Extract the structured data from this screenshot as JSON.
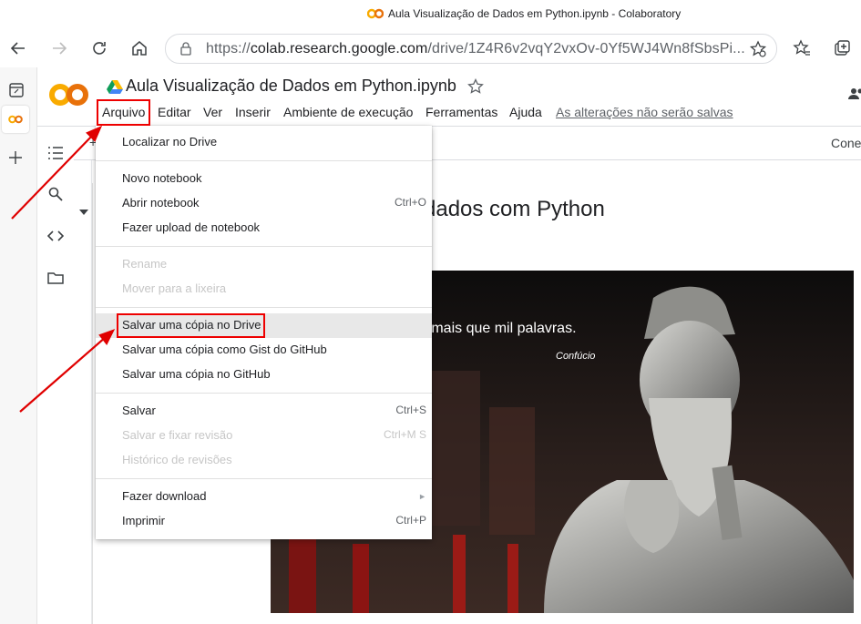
{
  "window": {
    "title": "Aula Visualização de Dados em Python.ipynb - Colaboratory"
  },
  "browser": {
    "url_prefix": "https://",
    "url_host": "colab.research.google.com",
    "url_path": "/drive/1Z4R6v2vqY2vxOv-0Yf5WJ4Wn8fSbsPi..."
  },
  "colab": {
    "logo_text": "CO",
    "filename": "Aula Visualização de Dados em Python.ipynb",
    "menu": [
      "Arquivo",
      "Editar",
      "Ver",
      "Inserir",
      "Ambiente de execução",
      "Ferramentas",
      "Ajuda"
    ],
    "unsaved_notice": "As alterações não serão salvas",
    "connect_label": "Cone",
    "toolbar_plus": "+"
  },
  "notebook": {
    "heading": "dados com Python",
    "quote": "e mais que mil palavras.",
    "quote_author": "Confúcio"
  },
  "file_menu": {
    "items": [
      {
        "label": "Localizar no Drive",
        "shortcut": "",
        "disabled": false
      },
      {
        "label": "Novo notebook",
        "shortcut": "",
        "disabled": false
      },
      {
        "label": "Abrir notebook",
        "shortcut": "Ctrl+O",
        "disabled": false
      },
      {
        "label": "Fazer upload de notebook",
        "shortcut": "",
        "disabled": false
      },
      {
        "label": "Rename",
        "shortcut": "",
        "disabled": true
      },
      {
        "label": "Mover para a lixeira",
        "shortcut": "",
        "disabled": true
      },
      {
        "label": "Salvar uma cópia no Drive",
        "shortcut": "",
        "disabled": false
      },
      {
        "label": "Salvar uma cópia como Gist do GitHub",
        "shortcut": "",
        "disabled": false
      },
      {
        "label": "Salvar uma cópia no GitHub",
        "shortcut": "",
        "disabled": false
      },
      {
        "label": "Salvar",
        "shortcut": "Ctrl+S",
        "disabled": false
      },
      {
        "label": "Salvar e fixar revisão",
        "shortcut": "Ctrl+M S",
        "disabled": true
      },
      {
        "label": "Histórico de revisões",
        "shortcut": "",
        "disabled": true
      },
      {
        "label": "Fazer download",
        "shortcut": "►",
        "disabled": false
      },
      {
        "label": "Imprimir",
        "shortcut": "Ctrl+P",
        "disabled": false
      }
    ]
  },
  "colors": {
    "logo_orange": "#f9ab00",
    "logo_dark_orange": "#e8710a",
    "annotation_red": "#e00000"
  }
}
